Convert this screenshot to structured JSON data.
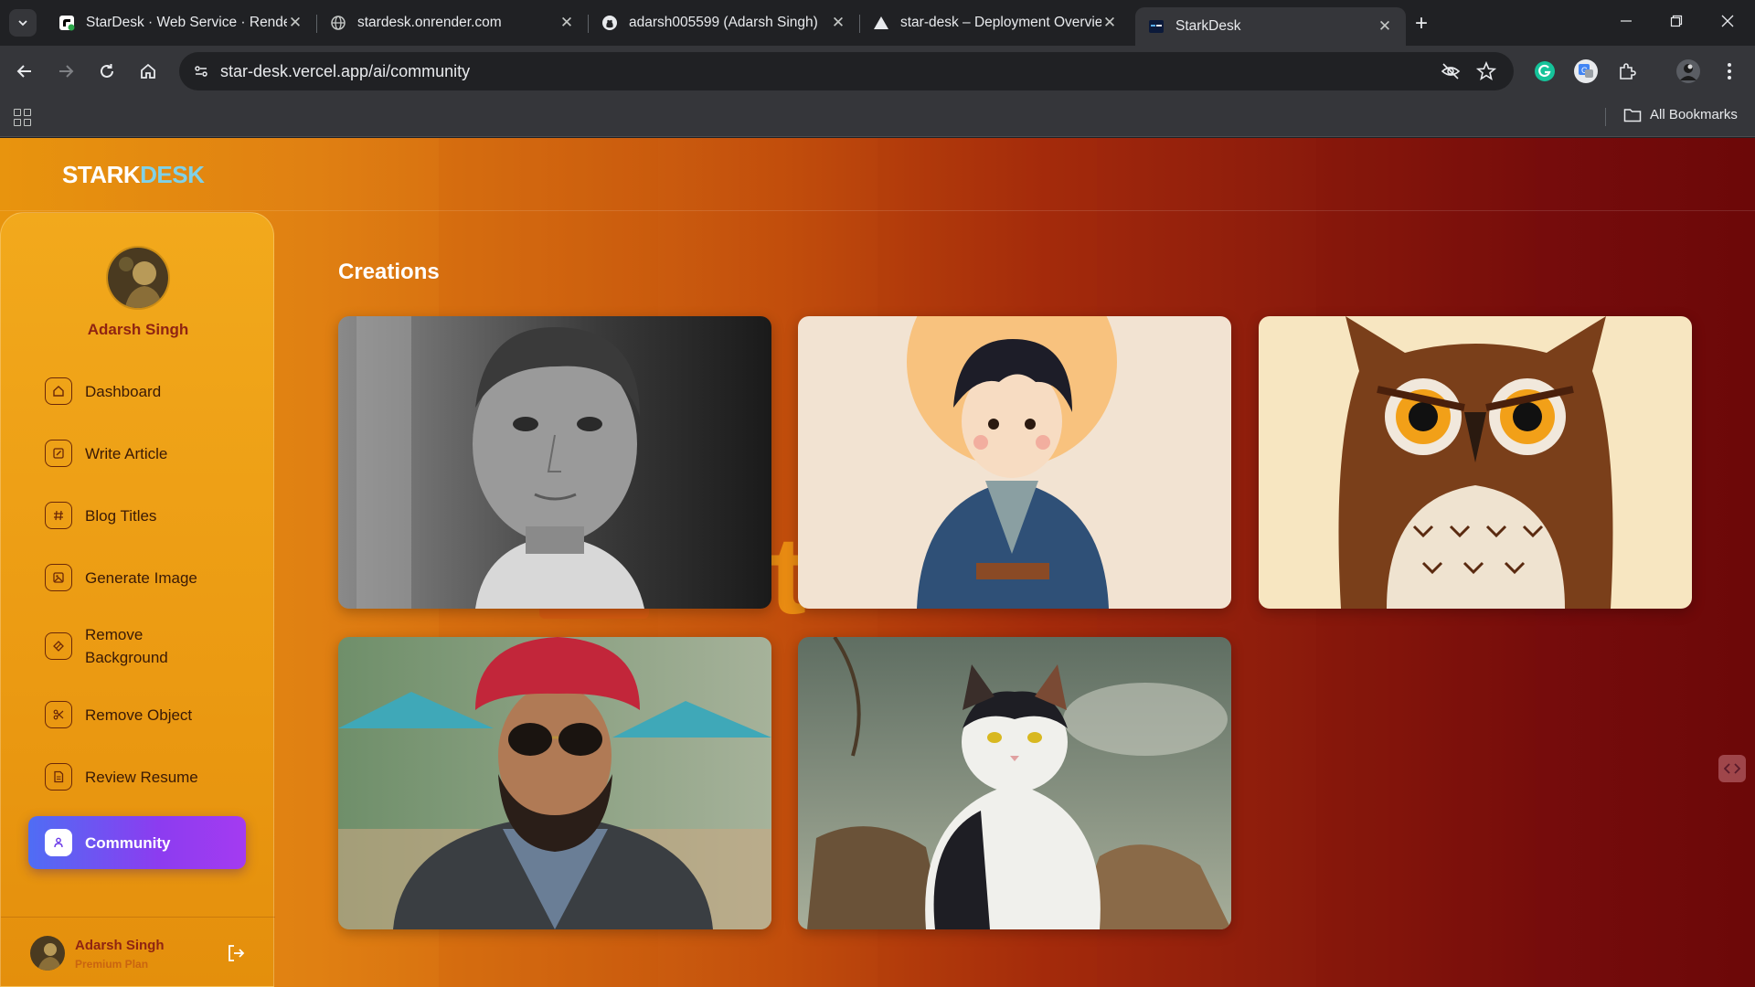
{
  "browser": {
    "tabs": [
      {
        "label": "StarDesk · Web Service · Render",
        "favicon": "render-icon"
      },
      {
        "label": "stardesk.onrender.com",
        "favicon": "globe-icon"
      },
      {
        "label": "adarsh005599 (Adarsh Singh)",
        "favicon": "github-icon"
      },
      {
        "label": "star-desk – Deployment Overview",
        "favicon": "vercel-icon"
      },
      {
        "label": "StarkDesk",
        "favicon": "starkdesk-icon"
      }
    ],
    "url": "star-desk.vercel.app/ai/community",
    "bookmarks_label": "All Bookmarks"
  },
  "app": {
    "logo_part1": "STARK",
    "logo_part2": "DESK",
    "user_name": "Adarsh Singh",
    "plan": "Premium Plan",
    "nav": [
      {
        "label": "Dashboard",
        "icon": "home-icon"
      },
      {
        "label": "Write Article",
        "icon": "edit-icon"
      },
      {
        "label": "Blog Titles",
        "icon": "hash-icon"
      },
      {
        "label": "Generate Image",
        "icon": "image-icon"
      },
      {
        "label": "Remove Background",
        "icon": "eraser-icon"
      },
      {
        "label": "Remove Object",
        "icon": "scissors-icon"
      },
      {
        "label": "Review Resume",
        "icon": "file-text-icon"
      },
      {
        "label": "Community",
        "icon": "users-icon"
      }
    ],
    "active_nav": "Community",
    "page_title": "Creations",
    "creations": [
      {
        "subject": "black and white portrait of a boy"
      },
      {
        "subject": "anime boy in blue kimono"
      },
      {
        "subject": "cartoon owl"
      },
      {
        "subject": "bearded man in red turban and sunglasses"
      },
      {
        "subject": "calico cat sitting on rocks"
      }
    ]
  },
  "colors": {
    "accent_gradient_start": "#4f6df4",
    "accent_gradient_end": "#a43bf1",
    "sidebar": "#f2a91c",
    "name_text": "#8f2412"
  }
}
